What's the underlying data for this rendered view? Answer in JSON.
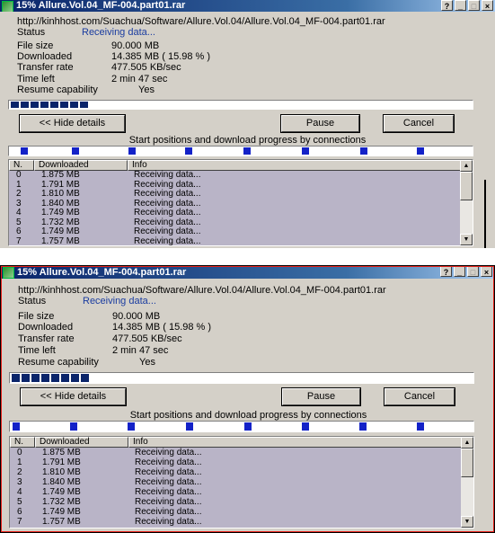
{
  "window": {
    "title": "15% Allure.Vol.04_MF-004.part01.rar",
    "buttons": [
      "?",
      "_",
      "□",
      "×"
    ]
  },
  "download": {
    "url": "http://kinhhost.com/Suachua/Software/Allure.Vol.04/Allure.Vol.04_MF-004.part01.rar",
    "status_label": "Status",
    "status_value": "Receiving data...",
    "fields": [
      {
        "label": "File size",
        "value": "90.000  MB"
      },
      {
        "label": "Downloaded",
        "value": "14.385  MB  ( 15.98 % )"
      },
      {
        "label": "Transfer rate",
        "value": "477.505  KB/sec"
      },
      {
        "label": "Time left",
        "value": "2 min 47 sec"
      },
      {
        "label": "Resume capability",
        "value": "Yes"
      }
    ],
    "progress_percent": 15.98,
    "progress_segments": 8
  },
  "buttons": {
    "hide_details": "<< Hide details",
    "pause": "Pause",
    "cancel": "Cancel"
  },
  "connections_caption": "Start positions and download progress by connections",
  "connection_count": 8,
  "table": {
    "headers": [
      "N.",
      "Downloaded",
      "Info"
    ],
    "rows": [
      [
        "0",
        "1.875  MB",
        "Receiving data..."
      ],
      [
        "1",
        "1.791  MB",
        "Receiving data..."
      ],
      [
        "2",
        "1.810  MB",
        "Receiving data..."
      ],
      [
        "3",
        "1.840  MB",
        "Receiving data..."
      ],
      [
        "4",
        "1.749  MB",
        "Receiving data..."
      ],
      [
        "5",
        "1.732  MB",
        "Receiving data..."
      ],
      [
        "6",
        "1.749  MB",
        "Receiving data..."
      ],
      [
        "7",
        "1.757  MB",
        "Receiving data..."
      ]
    ]
  },
  "colors": {
    "title_active": "#0a246a",
    "progress_fill": "#0a246a",
    "connection_marker": "#1322c8",
    "table_row_bg": "#b9b4c7",
    "status_value": "#1a3ca0",
    "highlight_border": "#e8221b"
  }
}
